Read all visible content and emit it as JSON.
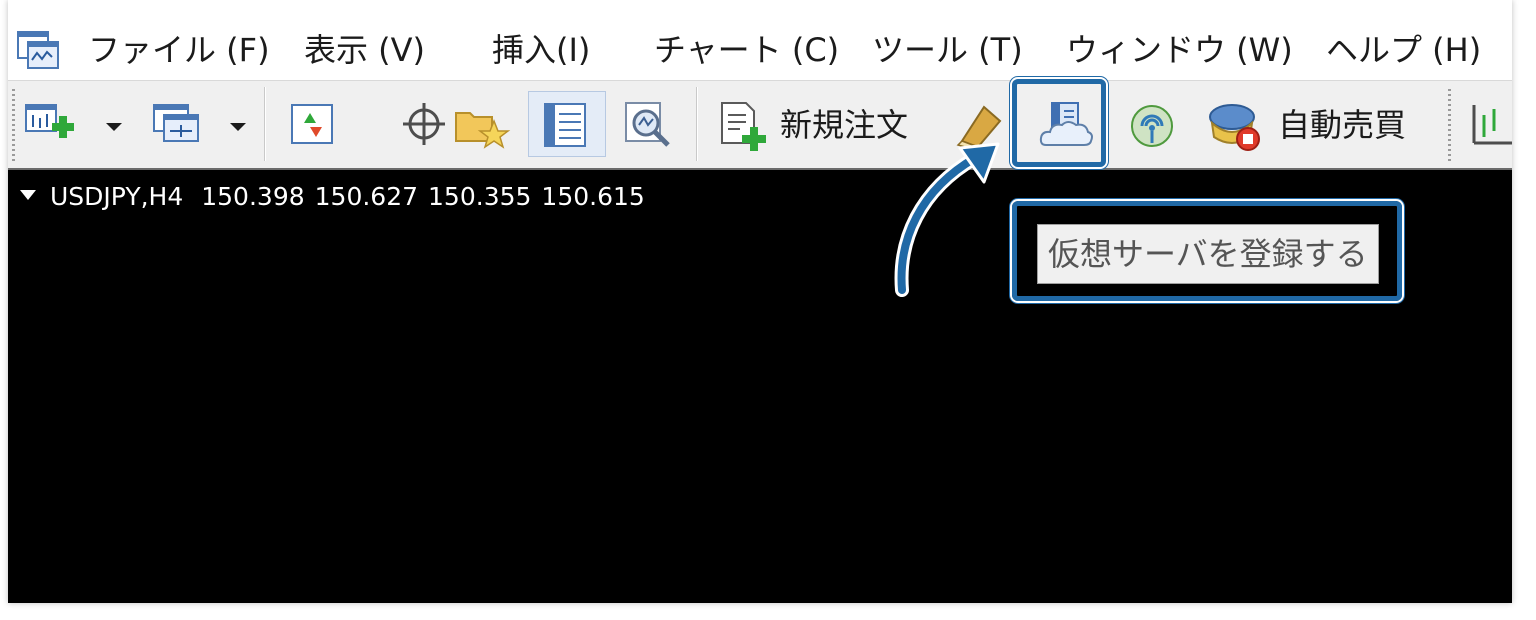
{
  "menu": {
    "items": [
      {
        "id": "file",
        "label": "ファイル (F)"
      },
      {
        "id": "view",
        "label": "表示 (V)"
      },
      {
        "id": "insert",
        "label": "挿入(I)"
      },
      {
        "id": "charts",
        "label": "チャート (C)"
      },
      {
        "id": "tools",
        "label": "ツール (T)"
      },
      {
        "id": "window",
        "label": "ウィンドウ (W)"
      },
      {
        "id": "help",
        "label": "ヘルプ (H)"
      }
    ]
  },
  "toolbar": {
    "new_order_label": "新規注文",
    "auto_trading_label": "自動売買",
    "icons": [
      "new-chart-icon",
      "profiles-icon",
      "market-watch-icon",
      "crosshair-icon",
      "navigator-icon",
      "data-window-icon",
      "strategy-tester-icon",
      "new-order-icon",
      "metaeditor-icon",
      "virtual-server-icon",
      "signals-icon",
      "auto-trading-icon",
      "period-icon"
    ]
  },
  "chart": {
    "symbol": "USDJPY,H4",
    "open": "150.398",
    "high": "150.627",
    "low": "150.355",
    "close": "150.615",
    "background": "#000000",
    "text_color": "#ffffff"
  },
  "tooltip": {
    "text": "仮想サーバを登録する"
  },
  "annotation": {
    "accent": "#2069a6"
  }
}
